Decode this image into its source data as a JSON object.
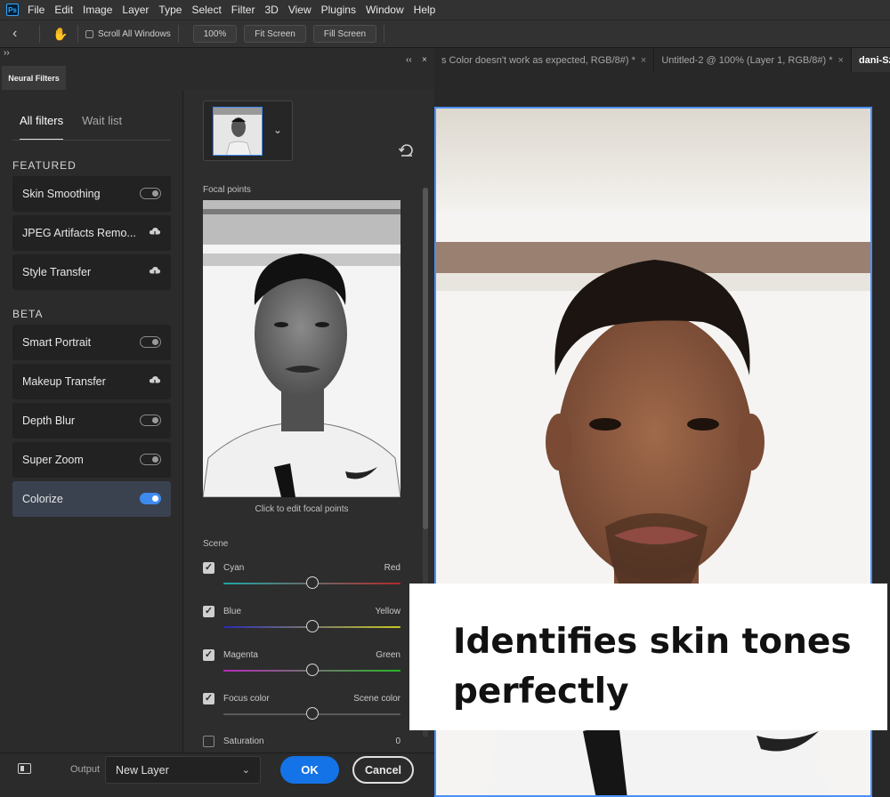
{
  "app": {
    "logo_text": "Ps"
  },
  "menubar": {
    "items": [
      "File",
      "Edit",
      "Image",
      "Layer",
      "Type",
      "Select",
      "Filter",
      "3D",
      "View",
      "Plugins",
      "Window",
      "Help"
    ]
  },
  "options_bar": {
    "scroll_all_windows": "Scroll All Windows",
    "zoom_100": "100%",
    "fit_screen": "Fit Screen",
    "fill_screen": "Fill Screen"
  },
  "doc_tabs": [
    {
      "label": "s Color doesn't work as expected, RGB/8#) *",
      "close": "×"
    },
    {
      "label": "Untitled-2 @ 100% (Layer 1, RGB/8#) *",
      "close": "×"
    },
    {
      "label": "dani-SzHsiY",
      "close": ""
    }
  ],
  "panel": {
    "title": "Neural Filters",
    "collapse_glyph": "››",
    "collapse2_glyph": "‹‹",
    "close_glyph": "×"
  },
  "filters_nav": {
    "all_filters": "All filters",
    "wait_list": "Wait list"
  },
  "sections": {
    "featured": "FEATURED",
    "beta": "BETA"
  },
  "featured": [
    {
      "label": "Skin Smoothing",
      "control": "toggle",
      "on": false
    },
    {
      "label": "JPEG Artifacts Remo...",
      "control": "cloud"
    },
    {
      "label": "Style Transfer",
      "control": "cloud"
    }
  ],
  "beta": [
    {
      "label": "Smart Portrait",
      "control": "toggle",
      "on": false
    },
    {
      "label": "Makeup Transfer",
      "control": "cloud"
    },
    {
      "label": "Depth Blur",
      "control": "toggle",
      "on": false
    },
    {
      "label": "Super Zoom",
      "control": "toggle",
      "on": false
    },
    {
      "label": "Colorize",
      "control": "toggle",
      "on": true
    }
  ],
  "colorize": {
    "focal_points_label": "Focal points",
    "preview_caption": "Click to edit focal points",
    "scene_label": "Scene",
    "sliders": [
      {
        "left": "Cyan",
        "right": "Red",
        "checked": true,
        "value": 0.5,
        "gradient": [
          "#1fa6a6",
          "#b32a2a"
        ]
      },
      {
        "left": "Blue",
        "right": "Yellow",
        "checked": true,
        "value": 0.5,
        "gradient": [
          "#2b2bb8",
          "#c8c820"
        ]
      },
      {
        "left": "Magenta",
        "right": "Green",
        "checked": true,
        "value": 0.5,
        "gradient": [
          "#b82bb8",
          "#27b827"
        ]
      },
      {
        "left": "Focus color",
        "right": "Scene color",
        "checked": true,
        "value": 0.5,
        "gradient": [
          "#5a5a5a",
          "#5a5a5a"
        ]
      },
      {
        "left": "Saturation",
        "right": "0",
        "checked": false,
        "value": 0.5,
        "gradient": [
          "#5a5a5a",
          "#5a5a5a"
        ]
      }
    ]
  },
  "footer": {
    "output_label": "Output",
    "output_value": "New Layer",
    "ok": "OK",
    "cancel": "Cancel"
  },
  "callout": {
    "line1": "Identifies skin tones",
    "line2": "perfectly"
  },
  "colors": {
    "accent": "#1473e6",
    "selection_border": "#4c8ff5",
    "panel_bg": "#2b2b2b"
  }
}
